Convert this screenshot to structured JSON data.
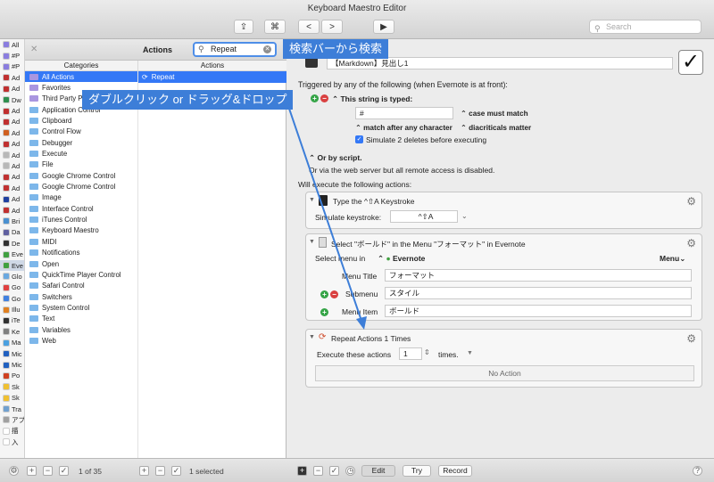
{
  "window": {
    "title": "Keyboard Maestro Editor"
  },
  "toolbar": {
    "share": "⇪",
    "cmd": "⌘",
    "back": "<",
    "forward": ">",
    "play": "▶",
    "search_placeholder": "Search"
  },
  "macro_groups": [
    {
      "label": "All",
      "color": "#8a7ddf"
    },
    {
      "label": "#P",
      "color": "#8a7ddf"
    },
    {
      "label": "#P",
      "color": "#8a7ddf"
    },
    {
      "label": "Ad",
      "color": "#c03030"
    },
    {
      "label": "Ad",
      "color": "#c03030"
    },
    {
      "label": "Dw",
      "color": "#2f8f4f"
    },
    {
      "label": "Ad",
      "color": "#c03030"
    },
    {
      "label": "Ad",
      "color": "#c03030"
    },
    {
      "label": "Ad",
      "color": "#d06020"
    },
    {
      "label": "Ad",
      "color": "#c03030"
    },
    {
      "label": "Ad",
      "color": "#b8b8b8"
    },
    {
      "label": "Ad",
      "color": "#b8b8b8"
    },
    {
      "label": "Ad",
      "color": "#c03030"
    },
    {
      "label": "Ad",
      "color": "#c03030"
    },
    {
      "label": "Ad",
      "color": "#2040a0"
    },
    {
      "label": "Ad",
      "color": "#c03030"
    },
    {
      "label": "Bri",
      "color": "#4a90d0"
    },
    {
      "label": "Da",
      "color": "#6060a0"
    },
    {
      "label": "De",
      "color": "#303030"
    },
    {
      "label": "Eve",
      "color": "#40a040"
    },
    {
      "label": "Eve",
      "color": "#40a040"
    },
    {
      "label": "Glo",
      "color": "#6aa8e0"
    },
    {
      "label": "Go",
      "color": "#e04040"
    },
    {
      "label": "Go",
      "color": "#4080e0"
    },
    {
      "label": "Illu",
      "color": "#e08020"
    },
    {
      "label": "iTe",
      "color": "#303030"
    },
    {
      "label": "Ke",
      "color": "#808080"
    },
    {
      "label": "Ma",
      "color": "#4aa0e0"
    },
    {
      "label": "Mic",
      "color": "#2060c0"
    },
    {
      "label": "Mic",
      "color": "#2060c0"
    },
    {
      "label": "Po",
      "color": "#d04020"
    },
    {
      "label": "Sk",
      "color": "#f0c030"
    },
    {
      "label": "Sk",
      "color": "#f0c030"
    },
    {
      "label": "Tra",
      "color": "#70a0d0"
    },
    {
      "label": "アプ",
      "color": "#a0a0a0"
    },
    {
      "label": "描",
      "color": "#ffffff"
    },
    {
      "label": "入",
      "color": "#ffffff"
    }
  ],
  "actions_panel": {
    "title": "Actions",
    "search_value": "Repeat",
    "categories_header": "Categories",
    "actions_header": "Actions",
    "categories": [
      "All Actions",
      "Favorites",
      "Third Party Plug Ins",
      "Application Control",
      "Clipboard",
      "Control Flow",
      "Debugger",
      "Execute",
      "File",
      "Google Chrome Control",
      "Google Chrome Control",
      "Image",
      "Interface Control",
      "iTunes Control",
      "Keyboard Maestro",
      "MIDI",
      "Notifications",
      "Open",
      "QuickTime Player Control",
      "Safari Control",
      "Switchers",
      "System Control",
      "Text",
      "Variables",
      "Web"
    ],
    "actions": [
      "Repeat"
    ]
  },
  "callouts": {
    "search": "検索バーから検索",
    "drag": "ダブルクリック or ドラッグ&ドロップ"
  },
  "editor": {
    "macro_name": "【Markdown】見出し1",
    "trigger_header": "Triggered by any of the following (when Evernote is at front):",
    "typed_label": "This string is typed:",
    "typed_value": "#",
    "case_label": "case must match",
    "match_label": "match after any character",
    "diacriticals_label": "diacriticals matter",
    "simulate_label": "Simulate 2 deletes before executing",
    "or_script": "Or by script.",
    "web_server": "Or via the web server but all remote access is disabled.",
    "will_execute": "Will execute the following actions:",
    "type_title": "Type the ^⇧A Keystroke",
    "simulate_keystroke": "Simulate keystroke:",
    "keystroke": "^⇧A",
    "select_title": "Select \"ボールド\" in the Menu \"フォーマット\" in Evernote",
    "select_menu_in": "Select menu in",
    "app": "Evernote",
    "menu_dropdown": "Menu",
    "menu_title_label": "Menu Title",
    "menu_title_value": "フォーマット",
    "submenu_label": "Submenu",
    "submenu_value": "スタイル",
    "menu_item_label": "Menu Item",
    "menu_item_value": "ボールド",
    "repeat_title": "Repeat Actions 1 Times",
    "execute_these": "Execute these actions",
    "repeat_count": "1",
    "times": "times.",
    "no_action": "No Action"
  },
  "bottombar": {
    "count": "1 of 35",
    "selected": "1 selected",
    "edit": "Edit",
    "try": "Try",
    "record": "Record",
    "help": "?"
  }
}
